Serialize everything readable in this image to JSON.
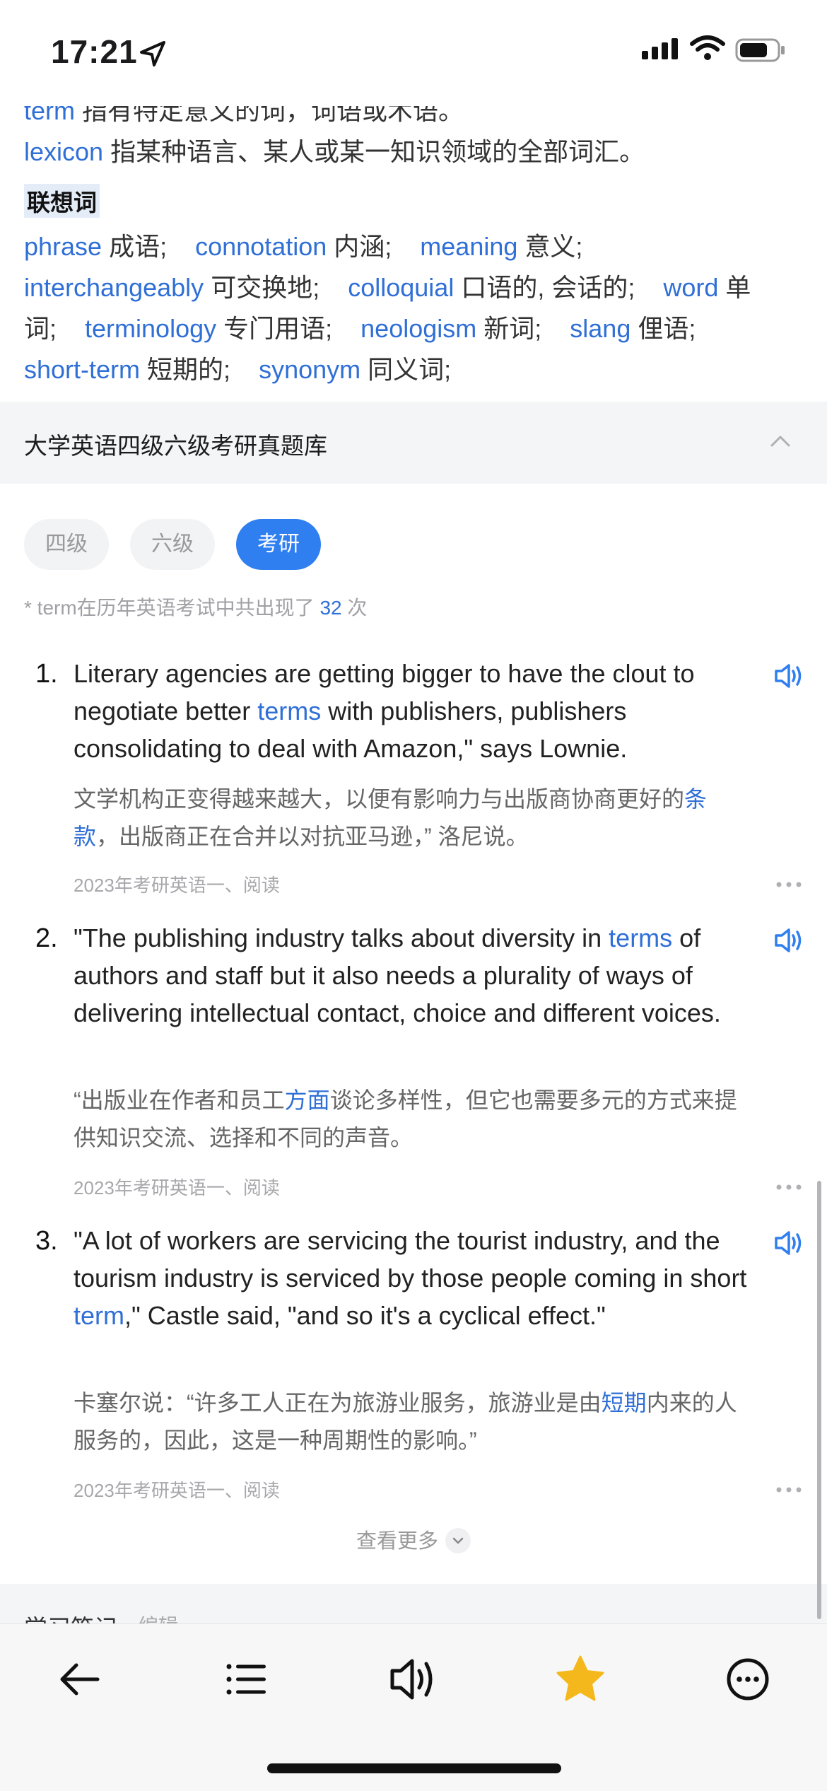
{
  "status": {
    "time": "17:21"
  },
  "synonyms": [
    {
      "word": "term",
      "desc": " 指有特定意义的词，词语或术语。"
    },
    {
      "word": "lexicon",
      "desc": " 指某种语言、某人或某一知识领域的全部词汇。"
    }
  ],
  "associations": {
    "title": "联想词",
    "items": [
      {
        "word": "phrase",
        "desc": " 成语;"
      },
      {
        "word": "connotation",
        "desc": " 内涵;"
      },
      {
        "word": "meaning",
        "desc": " 意义;"
      },
      {
        "word": "interchangeably",
        "desc": " 可交换地;"
      },
      {
        "word": "colloquial",
        "desc": " 口语的, 会话的;"
      },
      {
        "word": "word",
        "desc": " 单"
      },
      {
        "word": "",
        "desc": "词;"
      },
      {
        "word": "terminology",
        "desc": " 专门用语;"
      },
      {
        "word": "neologism",
        "desc": " 新词;"
      },
      {
        "word": "slang",
        "desc": " 俚语;"
      },
      {
        "word": "short-term",
        "desc": " 短期的;"
      },
      {
        "word": "synonym",
        "desc": " 同义词;"
      }
    ]
  },
  "exam_section": {
    "title": "大学英语四级六级考研真题库",
    "tabs": [
      "四级",
      "六级",
      "考研"
    ],
    "active_tab": "考研",
    "count_prefix": "* term在历年英语考试中共出现了 ",
    "count": "32",
    "count_suffix": " 次",
    "examples": [
      {
        "num": "1.",
        "en_before": "Literary agencies are getting bigger to have the clout to negotiate better ",
        "en_hl": "terms",
        "en_after": " with publishers, publishers consolidating to deal with Amazon,\" says Lownie.",
        "cn_before": "文学机构正变得越来越大，以便有影响力与出版商协商更好的",
        "cn_hl": "条款",
        "cn_after": "，出版商正在合并以对抗亚马逊，” 洛尼说。",
        "source": "2023年考研英语一、阅读"
      },
      {
        "num": "2.",
        "en_before": "\"The publishing industry talks about diversity in ",
        "en_hl": "terms",
        "en_after": " of authors and staff but it also needs a plurality of ways of delivering intellectual contact, choice and different voices.",
        "cn_before": "“出版业在作者和员工",
        "cn_hl": "方面",
        "cn_after": "谈论多样性，但它也需要多元的方式来提供知识交流、选择和不同的声音。",
        "source": "2023年考研英语一、阅读"
      },
      {
        "num": "3.",
        "en_before": "\"A lot of workers are servicing the tourist industry, and the tourism industry is serviced by those people coming in short ",
        "en_hl": "term",
        "en_after": ",\" Castle said, \"and so it's a cyclical effect.\"",
        "cn_before": "卡塞尔说：“许多工人正在为旅游业服务，旅游业是由",
        "cn_hl": "短期",
        "cn_after": "内来的人服务的，因此，这是一种周期性的影响。”",
        "source": "2023年考研英语一、阅读"
      }
    ],
    "see_more": "查看更多"
  },
  "notes": {
    "title": "学习笔记",
    "edit": "编辑"
  },
  "toolbar": {
    "icons": [
      "back-arrow-icon",
      "list-icon",
      "speaker-icon",
      "star-icon",
      "more-icon"
    ],
    "accent": "#f5b81c"
  },
  "colors": {
    "link": "#2f6fd6",
    "tab_active": "#2f7ff0"
  }
}
